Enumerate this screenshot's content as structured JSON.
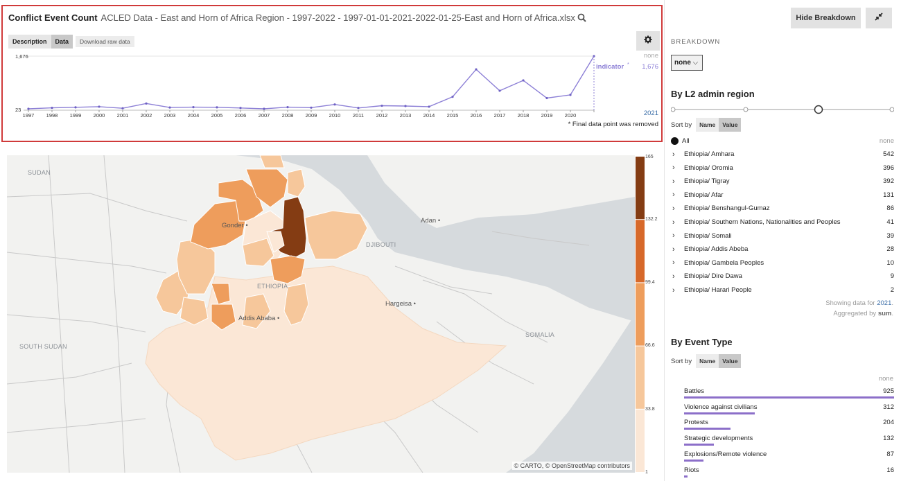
{
  "chart_panel": {
    "title": "Conflict Event Count",
    "subtitle": "ACLED Data - East and Horn of Africa Region - 1997-2022 - 1997-01-01-2021-2022-01-25-East and Horn of Africa.xlsx",
    "tabs": [
      "Description",
      "Data"
    ],
    "download_label": "Download raw data",
    "final_point_note": "* Final data point was removed",
    "series_label": "indicator",
    "series_asterisk": "*",
    "right_none_label": "none",
    "right_value": "1,676",
    "right_year": "2021"
  },
  "chart_data": {
    "type": "line",
    "x": [
      1997,
      1998,
      1999,
      2000,
      2001,
      2002,
      2003,
      2004,
      2005,
      2006,
      2007,
      2008,
      2009,
      2010,
      2011,
      2012,
      2013,
      2014,
      2015,
      2016,
      2017,
      2018,
      2019,
      2020,
      2021
    ],
    "series": [
      {
        "name": "indicator",
        "values": [
          23,
          53,
          70,
          90,
          40,
          190,
          65,
          75,
          70,
          50,
          23,
          75,
          60,
          160,
          50,
          120,
          110,
          90,
          400,
          1260,
          590,
          915,
          360,
          460,
          1676
        ]
      }
    ],
    "ylim": [
      23,
      1676
    ],
    "y_tick_labels": [
      "23",
      "1,676"
    ],
    "grid": false,
    "color": "#8c7fd6"
  },
  "map": {
    "labels": {
      "sudan": "SUDAN",
      "south_sudan": "SOUTH SUDAN",
      "djibouti": "DJIBOUTI",
      "ethiopia": "ETHIOPIA",
      "somalia": "SOMALIA"
    },
    "cities": {
      "gonder": "Gonder",
      "adan": "Adan",
      "addis_ababa": "Addis Ababa",
      "hargeisa": "Hargeisa"
    },
    "attribution": "© CARTO, © OpenStreetMap contributors",
    "legend_ticks": [
      "165",
      "132.2",
      "99.4",
      "66.6",
      "33.8",
      "1"
    ],
    "legend_colors": [
      "#843c13",
      "#d7692a",
      "#ee9d5c",
      "#f6c79b",
      "#fbe7d6"
    ]
  },
  "breakdown": {
    "hide_label": "Hide Breakdown",
    "label": "BREAKDOWN",
    "select_value": "none",
    "l2_title": "By L2 admin region",
    "sort_label": "Sort by",
    "sort_name": "Name",
    "sort_value": "Value",
    "all_label": "All",
    "none_label": "none",
    "regions": [
      {
        "name": "Ethiopia/ Amhara",
        "value": "542"
      },
      {
        "name": "Ethiopia/ Oromia",
        "value": "396"
      },
      {
        "name": "Ethiopia/ Tigray",
        "value": "392"
      },
      {
        "name": "Ethiopia/ Afar",
        "value": "131"
      },
      {
        "name": "Ethiopia/ Benshangul-Gumaz",
        "value": "86"
      },
      {
        "name": "Ethiopia/ Southern Nations, Nationalities and Peoples",
        "value": "41"
      },
      {
        "name": "Ethiopia/ Somali",
        "value": "39"
      },
      {
        "name": "Ethiopia/ Addis Abeba",
        "value": "28"
      },
      {
        "name": "Ethiopia/ Gambela Peoples",
        "value": "10"
      },
      {
        "name": "Ethiopia/ Dire Dawa",
        "value": "9"
      },
      {
        "name": "Ethiopia/ Harari People",
        "value": "2"
      }
    ],
    "showing_prefix": "Showing data for ",
    "showing_year": "2021",
    "showing_suffix": ".",
    "aggregated_prefix": "Aggregated by ",
    "aggregated_method": "sum",
    "aggregated_suffix": ".",
    "event_title": "By Event Type",
    "event_none_label": "none",
    "event_types": [
      {
        "name": "Battles",
        "value": "925",
        "fraction": 1.0
      },
      {
        "name": "Violence against civilians",
        "value": "312",
        "fraction": 0.337
      },
      {
        "name": "Protests",
        "value": "204",
        "fraction": 0.221
      },
      {
        "name": "Strategic developments",
        "value": "132",
        "fraction": 0.143
      },
      {
        "name": "Explosions/Remote violence",
        "value": "87",
        "fraction": 0.094
      },
      {
        "name": "Riots",
        "value": "16",
        "fraction": 0.017
      }
    ],
    "colors": {
      "bar": "#8c6fc9",
      "link": "#3b6ea8"
    }
  }
}
